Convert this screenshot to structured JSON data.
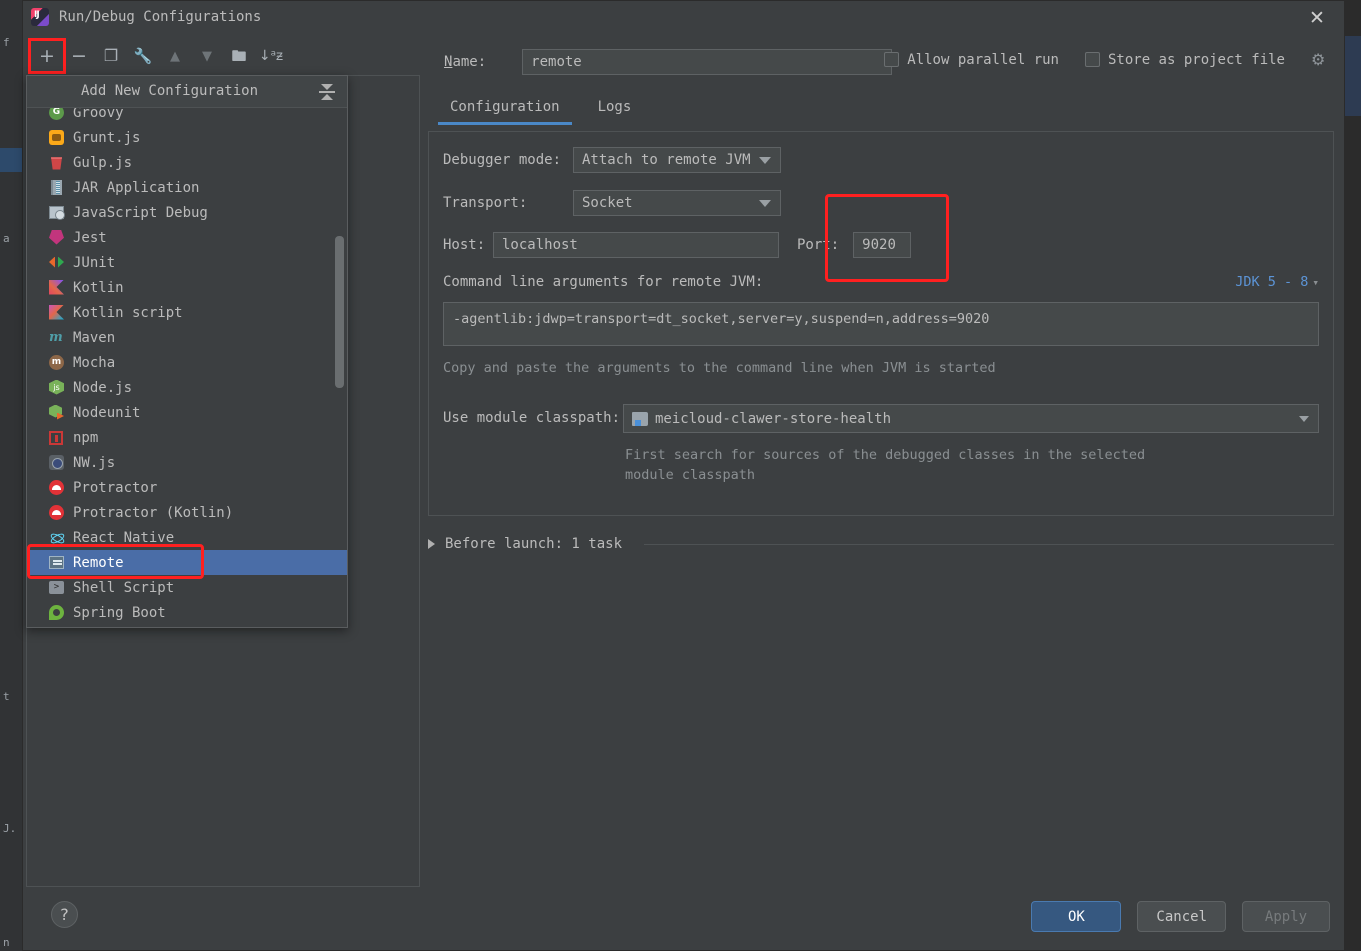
{
  "window": {
    "title": "Run/Debug Configurations",
    "app_icon": "intellij-idea-icon",
    "close_icon": "close-icon"
  },
  "toolbar": {
    "buttons": [
      {
        "name": "add-configuration",
        "glyph": "+",
        "enabled": true,
        "highlighted": true
      },
      {
        "name": "remove-configuration",
        "glyph": "−",
        "enabled": true,
        "highlighted": false
      },
      {
        "name": "copy-configuration",
        "glyph": "❐",
        "enabled": true,
        "highlighted": false
      },
      {
        "name": "edit-templates",
        "glyph": "🔧",
        "enabled": true,
        "highlighted": false
      },
      {
        "name": "move-up",
        "glyph": "▲",
        "enabled": false,
        "highlighted": false
      },
      {
        "name": "move-down",
        "glyph": "▼",
        "enabled": false,
        "highlighted": false
      },
      {
        "name": "create-folder",
        "glyph": "🗀",
        "enabled": true,
        "highlighted": false
      },
      {
        "name": "sort-alphabetically",
        "glyph": "↓ᵃᶻ",
        "enabled": true,
        "highlighted": false
      }
    ]
  },
  "popup": {
    "title": "Add New Configuration",
    "collapse_icon": "collapse-all-icon",
    "items": [
      {
        "label": "Groovy",
        "icon": "groovy-icon"
      },
      {
        "label": "Grunt.js",
        "icon": "grunt-icon"
      },
      {
        "label": "Gulp.js",
        "icon": "gulp-icon"
      },
      {
        "label": "JAR Application",
        "icon": "jar-icon"
      },
      {
        "label": "JavaScript Debug",
        "icon": "javascript-debug-icon"
      },
      {
        "label": "Jest",
        "icon": "jest-icon"
      },
      {
        "label": "JUnit",
        "icon": "junit-icon"
      },
      {
        "label": "Kotlin",
        "icon": "kotlin-icon"
      },
      {
        "label": "Kotlin script",
        "icon": "kotlin-script-icon"
      },
      {
        "label": "Maven",
        "icon": "maven-icon"
      },
      {
        "label": "Mocha",
        "icon": "mocha-icon"
      },
      {
        "label": "Node.js",
        "icon": "nodejs-icon"
      },
      {
        "label": "Nodeunit",
        "icon": "nodeunit-icon"
      },
      {
        "label": "npm",
        "icon": "npm-icon"
      },
      {
        "label": "NW.js",
        "icon": "nwjs-icon"
      },
      {
        "label": "Protractor",
        "icon": "protractor-icon"
      },
      {
        "label": "Protractor (Kotlin)",
        "icon": "protractor-kotlin-icon"
      },
      {
        "label": "React Native",
        "icon": "react-native-icon"
      },
      {
        "label": "Remote",
        "icon": "remote-icon",
        "selected": true
      },
      {
        "label": "Shell Script",
        "icon": "shell-script-icon"
      },
      {
        "label": "Spring Boot",
        "icon": "spring-boot-icon"
      }
    ]
  },
  "form": {
    "name_label": "Name:",
    "name_value": "remote",
    "allow_parallel_run": {
      "label": "Allow parallel run",
      "checked": false
    },
    "store_as_project_file": {
      "label": "Store as project file",
      "checked": false
    },
    "settings_icon": "gear-icon",
    "tabs": [
      {
        "label": "Configuration",
        "active": true
      },
      {
        "label": "Logs",
        "active": false
      }
    ],
    "debugger_mode_label": "Debugger mode:",
    "debugger_mode_value": "Attach to remote JVM",
    "transport_label": "Transport:",
    "transport_value": "Socket",
    "host_label": "Host:",
    "host_value": "localhost",
    "port_label": "Port:",
    "port_value": "9020",
    "args_label": "Command line arguments for remote JVM:",
    "jdk_link": "JDK 5 - 8",
    "args_value": "-agentlib:jdwp=transport=dt_socket,server=y,suspend=n,address=9020",
    "args_hint": "Copy and paste the arguments to the command line when JVM is started",
    "module_classpath_label": "Use module classpath:",
    "module_classpath_value": "meicloud-clawer-store-health",
    "module_icon": "module-icon",
    "module_hint_line1": "First search for sources of the debugged classes in the selected",
    "module_hint_line2": "module classpath",
    "before_launch_label": "Before launch: 1 task"
  },
  "footer": {
    "help_label": "?",
    "buttons": [
      {
        "label": "OK",
        "style": "primary",
        "enabled": true
      },
      {
        "label": "Cancel",
        "style": "default",
        "enabled": true
      },
      {
        "label": "Apply",
        "style": "disabled",
        "enabled": false
      }
    ]
  },
  "annotations": {
    "color": "#ff2020",
    "regions": [
      "add-configuration-button",
      "remote-list-item",
      "port-field"
    ]
  }
}
